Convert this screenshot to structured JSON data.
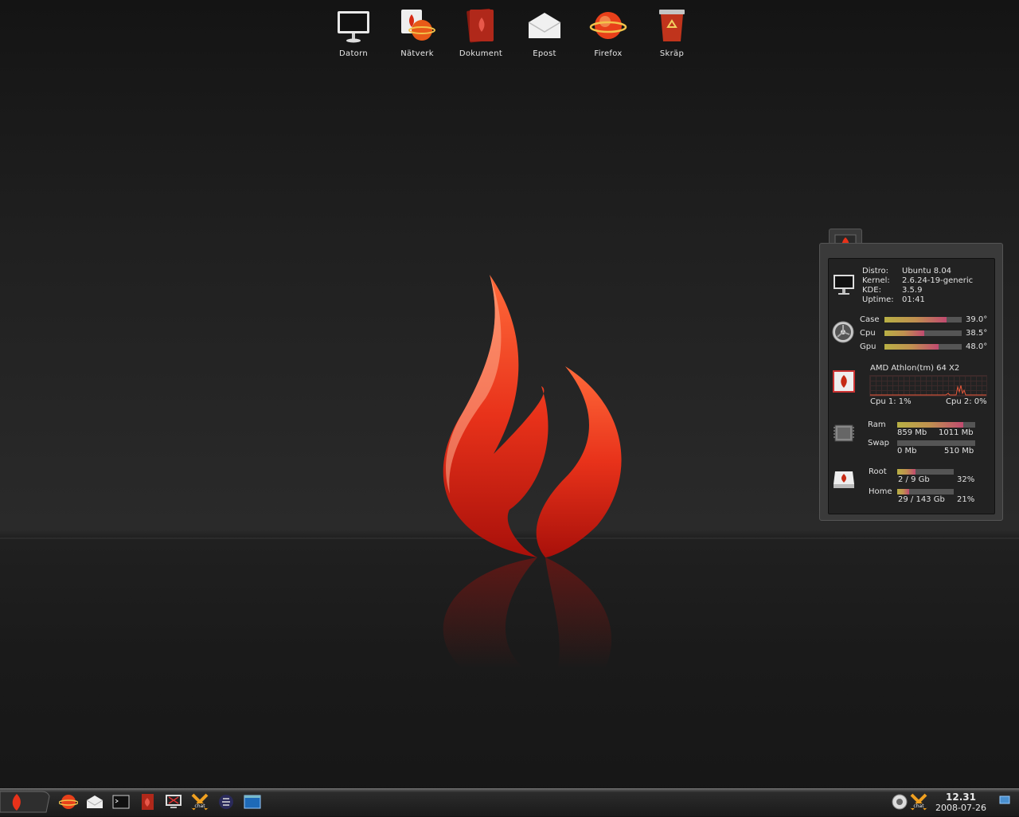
{
  "desktop_icons": [
    {
      "label": "Datorn",
      "icon": "monitor-icon"
    },
    {
      "label": "Nätverk",
      "icon": "network-globe-icon"
    },
    {
      "label": "Dokument",
      "icon": "documents-folder-icon"
    },
    {
      "label": "Epost",
      "icon": "mail-envelope-icon"
    },
    {
      "label": "Firefox",
      "icon": "firefox-icon"
    },
    {
      "label": "Skräp",
      "icon": "trash-icon"
    }
  ],
  "sysmon": {
    "system": {
      "distro_label": "Distro:",
      "distro_value": "Ubuntu 8.04",
      "kernel_label": "Kernel:",
      "kernel_value": "2.6.24-19-generic",
      "kde_label": "KDE:",
      "kde_value": "3.5.9",
      "uptime_label": "Uptime:",
      "uptime_value": "01:41"
    },
    "temps": [
      {
        "label": "Case",
        "value": "39.0°",
        "level": 0.8
      },
      {
        "label": "Cpu",
        "value": "38.5°",
        "level": 0.52
      },
      {
        "label": "Gpu",
        "value": "48.0°",
        "level": 0.7
      }
    ],
    "cpu": {
      "name": "AMD Athlon(tm) 64 X2",
      "cpu1": "Cpu 1: 1%",
      "cpu2": "Cpu 2: 0%"
    },
    "memory": {
      "ram_label": "Ram",
      "ram_used": "859 Mb",
      "ram_total": "1011 Mb",
      "ram_level": 0.85,
      "swap_label": "Swap",
      "swap_used": "0 Mb",
      "swap_total": "510 Mb",
      "swap_level": 0.0
    },
    "disks": {
      "root_label": "Root",
      "root_usage": "2 / 9 Gb",
      "root_percent": "32%",
      "root_level": 0.32,
      "home_label": "Home",
      "home_usage": "29 / 143 Gb",
      "home_percent": "21%",
      "home_level": 0.21
    }
  },
  "taskbar": {
    "launchers": [
      "firefox-icon",
      "mail-icon",
      "terminal-icon",
      "documents-icon",
      "system-monitor-icon",
      "chat-icon",
      "eclipse-icon",
      "window-icon"
    ],
    "tray": [
      "network-tray-icon",
      "chat-tray-icon"
    ],
    "clock_time": "12.31",
    "clock_date": "2008-07-26"
  },
  "colors": {
    "accent": "#e8321a",
    "bar_start": "#b8b044",
    "bar_end": "#c04a70"
  }
}
